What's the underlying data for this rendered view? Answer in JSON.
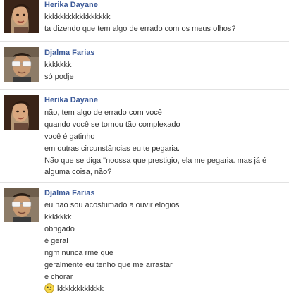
{
  "messages": [
    {
      "author": "Herika Dayane",
      "lines": [
        "kkkkkkkkkkkkkkkkk",
        "ta dizendo que tem algo de errado com os meus olhos?"
      ]
    },
    {
      "author": "Djalma Farias",
      "lines": [
        "kkkkkkk",
        "só podje"
      ]
    },
    {
      "author": "Herika Dayane",
      "lines": [
        "não, tem algo de errado com você",
        "quando você se tornou tão complexado",
        "você é gatinho",
        "em outras circunstâncias eu te pegaria.",
        "Não que se diga \"noossa que prestigio, ela me pegaria. mas já é alguma coisa, não?"
      ]
    },
    {
      "author": "Djalma Farias",
      "lines": [
        "eu nao sou acostumado a ouvir elogios",
        "kkkkkkk",
        "obrigado",
        "é geral",
        "ngm nunca rme que",
        "geralmente eu tenho que me arrastar",
        "e chorar",
        "kkkkkkkkkkkk"
      ],
      "last_line_emoticon": "confused-face-icon"
    }
  ]
}
